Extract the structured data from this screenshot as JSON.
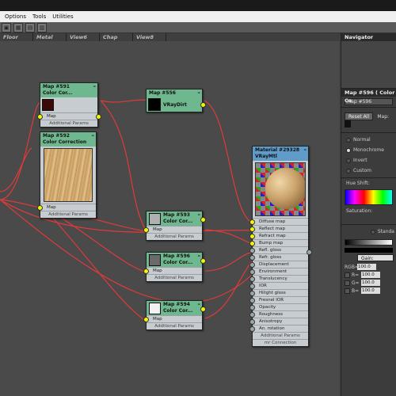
{
  "menu": [
    "Options",
    "Tools",
    "Utilities"
  ],
  "view_tabs": [
    "Floor",
    "Metal",
    "View6",
    "Chap",
    "View8"
  ],
  "nodes": {
    "map591": {
      "title1": "Map #591",
      "title2": "Color Cor...",
      "slot": "Map",
      "params": "Additional Params",
      "swatch_color": "#3a0a08"
    },
    "map592": {
      "title1": "Map #592",
      "title2": "Color Correction",
      "slot": "Map",
      "params": "Additional Params"
    },
    "map556": {
      "title1": "Map #556",
      "title2": "VRayDirt",
      "swatch_color": "#000000"
    },
    "map593": {
      "title1": "Map #593",
      "title2": "Color Cor...",
      "slot": "Map",
      "params": "Additional Params",
      "swatch_color": "#b0b0b0"
    },
    "map596": {
      "title1": "Map #596",
      "title2": "Color Cor...",
      "slot": "Map",
      "params": "Additional Params",
      "swatch_color": "#6a6a6a"
    },
    "map594": {
      "title1": "Map #594",
      "title2": "Color Cor...",
      "slot": "Map",
      "params": "Additional Params",
      "swatch_color": "#f2f2f2"
    },
    "material": {
      "title1": "Material #29328",
      "title2": "VRayMtl",
      "slots": [
        "Diffuse map",
        "Reflect map",
        "Refract map",
        "Bump map",
        "Refl. gloss",
        "Refr. gloss",
        "Displacement",
        "Environment",
        "Translucency",
        "IOR",
        "Hilight gloss",
        "Fresnel IOR",
        "Opacity",
        "Roughness",
        "Anisotropy",
        "An. rotation"
      ],
      "params": "Additional Params",
      "mr": "mr Connection"
    }
  },
  "right_panel": {
    "navigator": "Navigator",
    "map_title": "Map #596  ( Color Co",
    "map_name": "Map #596",
    "reset_all": "Reset All",
    "map_label": "Map:",
    "radios": [
      "Normal",
      "Monochrome",
      "Invert",
      "Custom"
    ],
    "radio_selected": 1,
    "hue_shift": "Hue Shift:",
    "saturation": "Saturation:",
    "standard": "Standa",
    "gain": "Gain:",
    "rgb_label": "RGB=",
    "rgb_value": "100.0",
    "r_label": "R=",
    "r_value": "100.0",
    "g_label": "G=",
    "g_value": "100.0",
    "b_label": "B=",
    "b_value": "100.0"
  }
}
